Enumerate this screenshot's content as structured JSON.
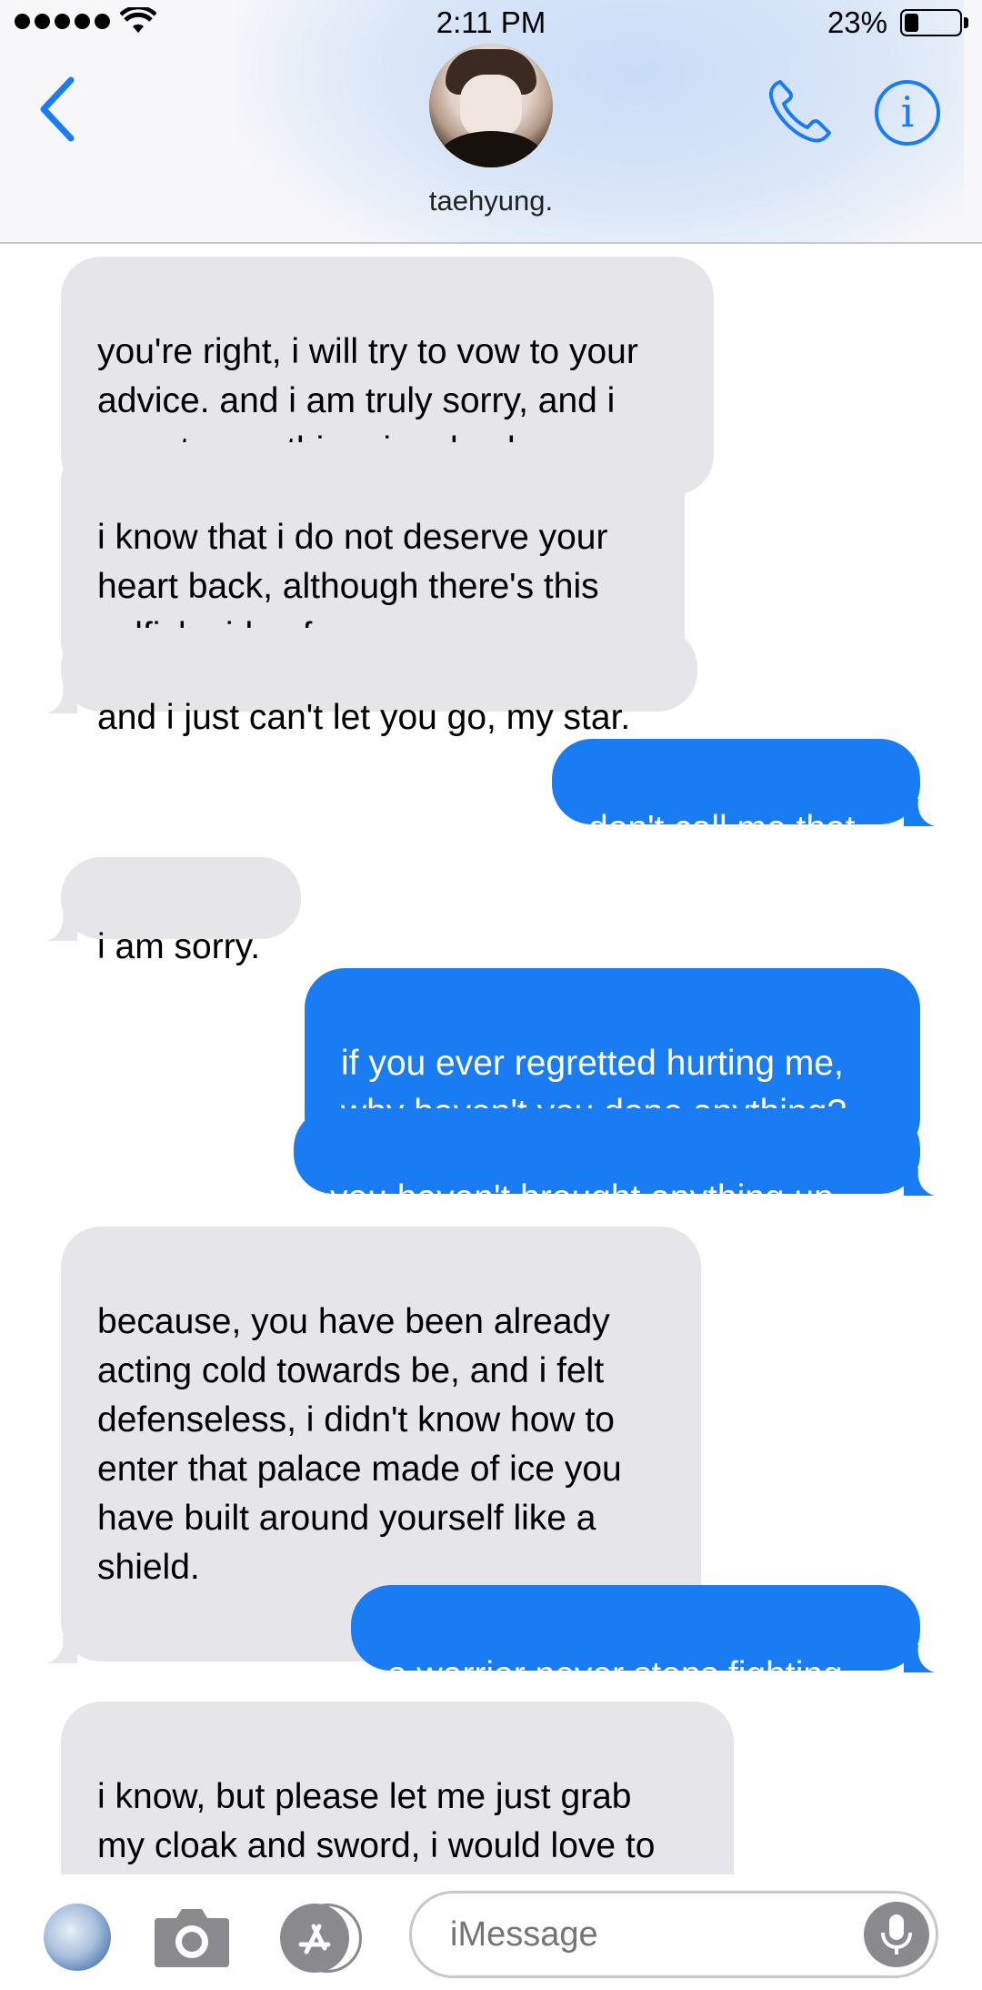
{
  "status_bar": {
    "time": "2:11 PM",
    "battery_percent": "23%",
    "battery_level": 0.23,
    "signal_bars": 5
  },
  "header": {
    "contact_name": "taehyung.",
    "back_icon": "chevron-left-icon",
    "call_icon": "phone-icon",
    "info_icon": "info-icon",
    "info_glyph": "i",
    "accent_color": "#1a7cf2"
  },
  "messages": [
    {
      "direction": "received",
      "text": "you're right, i will try to vow to your\nadvice. and i am truly sorry, and i\nregret everything, jungkook."
    },
    {
      "direction": "received",
      "text": "i know that i do not deserve your\nheart back, although there's this\nselfish side of me"
    },
    {
      "direction": "received",
      "text": "and i just can't let you go, my star."
    },
    {
      "direction": "sent",
      "text": "don't call me that."
    },
    {
      "direction": "received",
      "text": "i am sorry."
    },
    {
      "direction": "sent",
      "text": "if you ever regretted hurting me,\nwhy haven't you done anything?"
    },
    {
      "direction": "sent",
      "text": "you haven't brought anything up."
    },
    {
      "direction": "received",
      "text": "because, you have been already\nacting cold towards be, and i felt\ndefenseless, i didn't know how to\nenter that palace made of ice you\nhave built around yourself like a\nshield."
    },
    {
      "direction": "sent",
      "text": "a warrior never stops fighting."
    },
    {
      "direction": "received",
      "text": "i know, but please let me just grab\nmy cloak and sword, i would love to\nfight myself and enter your palace"
    }
  ],
  "input_bar": {
    "placeholder": "iMessage",
    "photos_icon": "photos-icon",
    "camera_icon": "camera-icon",
    "app_store_icon": "app-store-icon",
    "mic_icon": "microphone-icon"
  },
  "colors": {
    "sent_bubble": "#1a7cf2",
    "received_bubble": "#e5e5ea"
  }
}
